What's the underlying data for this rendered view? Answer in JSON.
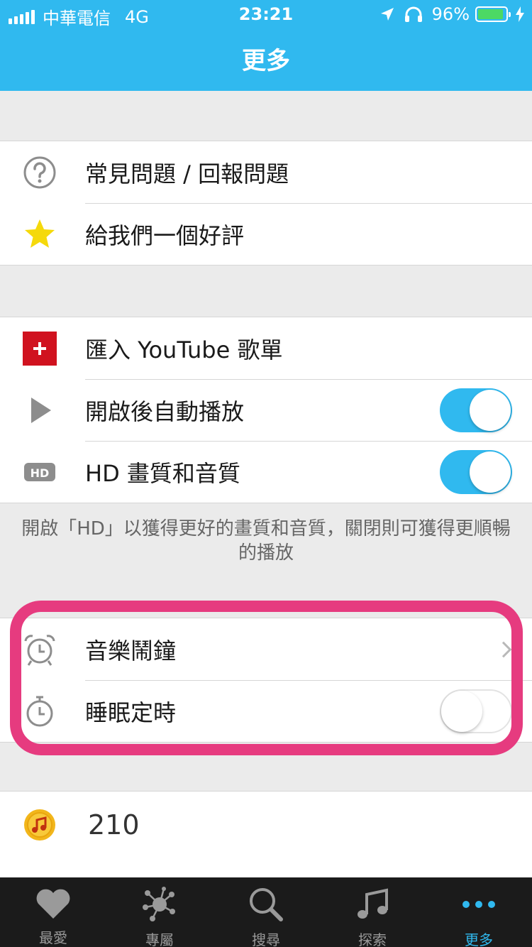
{
  "status_bar": {
    "carrier": "中華電信",
    "network": "4G",
    "time": "23:21",
    "battery": "96%",
    "battery_level": 0.96
  },
  "header": {
    "title": "更多"
  },
  "section1": {
    "items": [
      {
        "label": "常見問題 / 回報問題",
        "icon": "help-circle-icon"
      },
      {
        "label": "給我們一個好評",
        "icon": "star-icon"
      }
    ]
  },
  "section2": {
    "items": [
      {
        "label": "匯入 YouTube 歌單",
        "icon": "plus-red-icon"
      },
      {
        "label": "開啟後自動播放",
        "icon": "play-icon",
        "toggle": true
      },
      {
        "label": "HD 畫質和音質",
        "icon": "hd-icon",
        "toggle": true
      }
    ],
    "footnote": "開啟「HD」以獲得更好的畫質和音質，關閉則可獲得更順暢的播放"
  },
  "section3": {
    "items": [
      {
        "label": "音樂鬧鐘",
        "icon": "alarm-clock-icon"
      },
      {
        "label": "睡眠定時",
        "icon": "stopwatch-icon",
        "toggle": false
      }
    ]
  },
  "section4": {
    "coins": "210",
    "icon": "music-coin-icon"
  },
  "tabbar": {
    "tabs": [
      {
        "label": "最愛",
        "icon": "heart-icon"
      },
      {
        "label": "專屬",
        "icon": "network-icon"
      },
      {
        "label": "搜尋",
        "icon": "search-icon"
      },
      {
        "label": "探索",
        "icon": "music-note-icon"
      },
      {
        "label": "更多",
        "icon": "more-dots-icon",
        "active": true
      }
    ]
  },
  "colors": {
    "accent": "#30b9ef",
    "highlight": "#e63b7f",
    "youtube_red": "#d0121f",
    "star": "#f5d90b",
    "tabbar_bg": "#1b1b1b"
  }
}
